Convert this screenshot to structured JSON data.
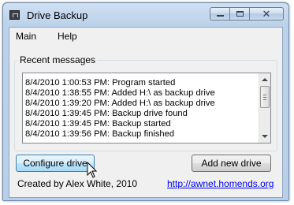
{
  "window": {
    "title": "Drive Backup"
  },
  "menu": {
    "items": [
      "Main",
      "Help"
    ]
  },
  "recent": {
    "label": "Recent messages",
    "messages": [
      "8/4/2010 1:00:53 PM: Program started",
      "8/4/2010 1:38:55 PM: Added H:\\ as backup drive",
      "8/4/2010 1:39:20 PM: Added H:\\ as backup drive",
      "8/4/2010 1:39:45 PM: Backup drive found",
      "8/4/2010 1:39:45 PM: Backup started",
      "8/4/2010 1:39:56 PM: Backup finished"
    ]
  },
  "buttons": {
    "configure": "Configure drive",
    "add": "Add new drive"
  },
  "footer": {
    "credit": "Created by Alex White, 2010",
    "link": "http://awnet.homends.org"
  }
}
